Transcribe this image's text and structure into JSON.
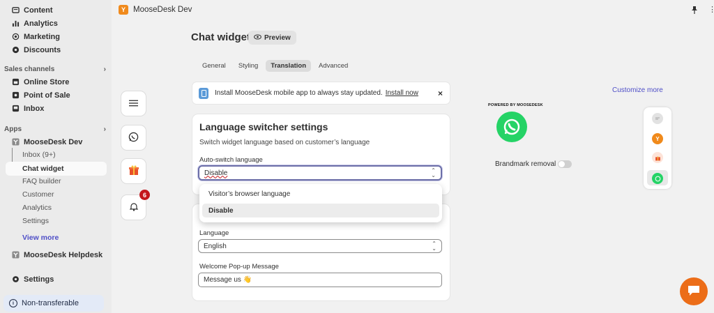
{
  "sidebar": {
    "top_items": [
      {
        "label": "Content",
        "icon": "content-icon"
      },
      {
        "label": "Analytics",
        "icon": "bar-chart-icon"
      },
      {
        "label": "Marketing",
        "icon": "target-icon"
      },
      {
        "label": "Discounts",
        "icon": "gear-badge-icon"
      }
    ],
    "sales_channels_label": "Sales channels",
    "sales_channels": [
      {
        "label": "Online Store",
        "icon": "store-icon"
      },
      {
        "label": "Point of Sale",
        "icon": "pos-icon"
      },
      {
        "label": "Inbox",
        "icon": "inbox-icon"
      }
    ],
    "apps_label": "Apps",
    "app_main": "MooseDesk Dev",
    "app_subitems": [
      "Inbox (9+)",
      "Chat widget",
      "FAQ builder",
      "Customer",
      "Analytics",
      "Settings"
    ],
    "view_more": "View more",
    "app_helpdesk": "MooseDesk Helpdesk",
    "settings": "Settings",
    "non_transferable": "Non-transferable"
  },
  "topbar": {
    "app_title": "MooseDesk Dev"
  },
  "page": {
    "title": "Chat widget",
    "preview_label": "Preview",
    "tabs": [
      "General",
      "Styling",
      "Translation",
      "Advanced"
    ],
    "active_tab": "Translation"
  },
  "banner": {
    "text": "Install MooseDesk mobile app to always stay updated.",
    "link": "Install now"
  },
  "language_card": {
    "title": "Language switcher settings",
    "description": "Switch widget language based on customer’s language",
    "auto_switch_label": "Auto-switch language",
    "auto_switch_value": "Disable",
    "options": [
      "Visitor’s browser language",
      "Disable"
    ],
    "selected_option": "Disable"
  },
  "second_card": {
    "language_label": "Language",
    "language_value": "English",
    "welcome_label": "Welcome Pop-up Message",
    "welcome_value": "Message us 👋"
  },
  "side_icons": {
    "badge_count": "6"
  },
  "preview": {
    "customize_more": "Customize more",
    "powered_by": "POWERED BY MOOSEDESK",
    "brandmark_removal": "Brandmark removal"
  },
  "colors": {
    "accent": "#4e4ec7",
    "whatsapp": "#25d366",
    "brand_orange": "#ec6d18",
    "badge_red": "#c4161c"
  }
}
